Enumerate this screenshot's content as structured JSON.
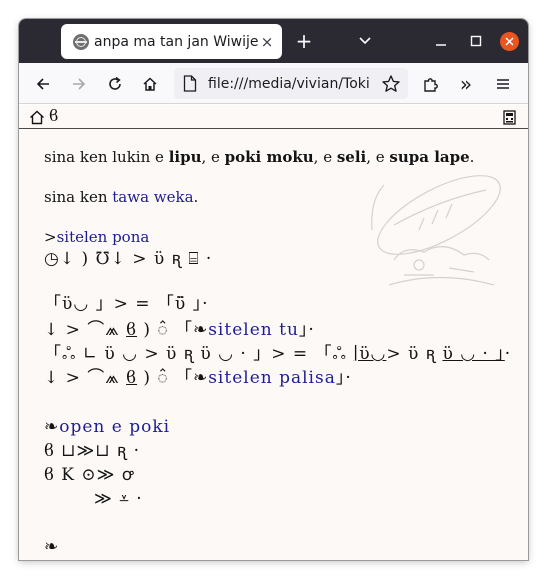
{
  "browser": {
    "tab_title": "anpa ma tan jan Wiwijen",
    "tab_close": "×",
    "new_tab": "+",
    "list_all_tabs": "⌄",
    "minimize": "—",
    "maximize": "□",
    "close": "×",
    "url": "file:///media/vivian/Toki",
    "overflow": "»",
    "menu": "≡"
  },
  "page": {
    "bar_glyph": "ϐ",
    "line1": {
      "a": "sina ken lukin e ",
      "b": "lipu",
      "c": ", e ",
      "d": "poki moku",
      "e": ", e ",
      "f": "seli",
      "g": ", e ",
      "h": "supa lape",
      "i": "."
    },
    "line2": {
      "a": "sina ken ",
      "link": "tawa weka",
      "b": "."
    },
    "line3": {
      "a": ">",
      "link": "sitelen pona"
    },
    "line4": "◷↓ ) ℧↓ > ϋ ꭆ ⌸ ·",
    "line5": "「ϋ◡ 」> = 「ϋ̈ 」·",
    "line6": {
      "a": " ↓ > ⌒⩕ ",
      "u": "ϐ",
      "b": " ) ꠆ 「❧",
      "link": "sitelen tu",
      "c": "」·"
    },
    "line7": {
      "a": "「ஃ ∟ ϋ ◡ > ϋ ꭆ ϋ ◡ · 」> = 「ஃ ",
      "u": "∣ϋ◡",
      "b": "> ϋ ꭆ ",
      "u2": "ϋ ◡ · 」",
      "c": "·"
    },
    "line8": {
      "a": " ↓ > ⌒⩕ ",
      "u": "ϐ",
      "b": " ) ꠆ 「❧",
      "link": "sitelen palisa",
      "c": "」·"
    },
    "line9": {
      "a": "❧",
      "link": "open e poki"
    },
    "line10": "ϐ ⊔≫⊔ ꭆ ·",
    "line11": "ϐ K ⊙≫ ꝍ",
    "line12": "≫ ⩡ ·",
    "line13": "❧"
  },
  "colors": {
    "link": "#1d1d94",
    "page_bg": "#fdf9f7",
    "titlebar": "#2b2a33",
    "close_button": "#e95420"
  }
}
